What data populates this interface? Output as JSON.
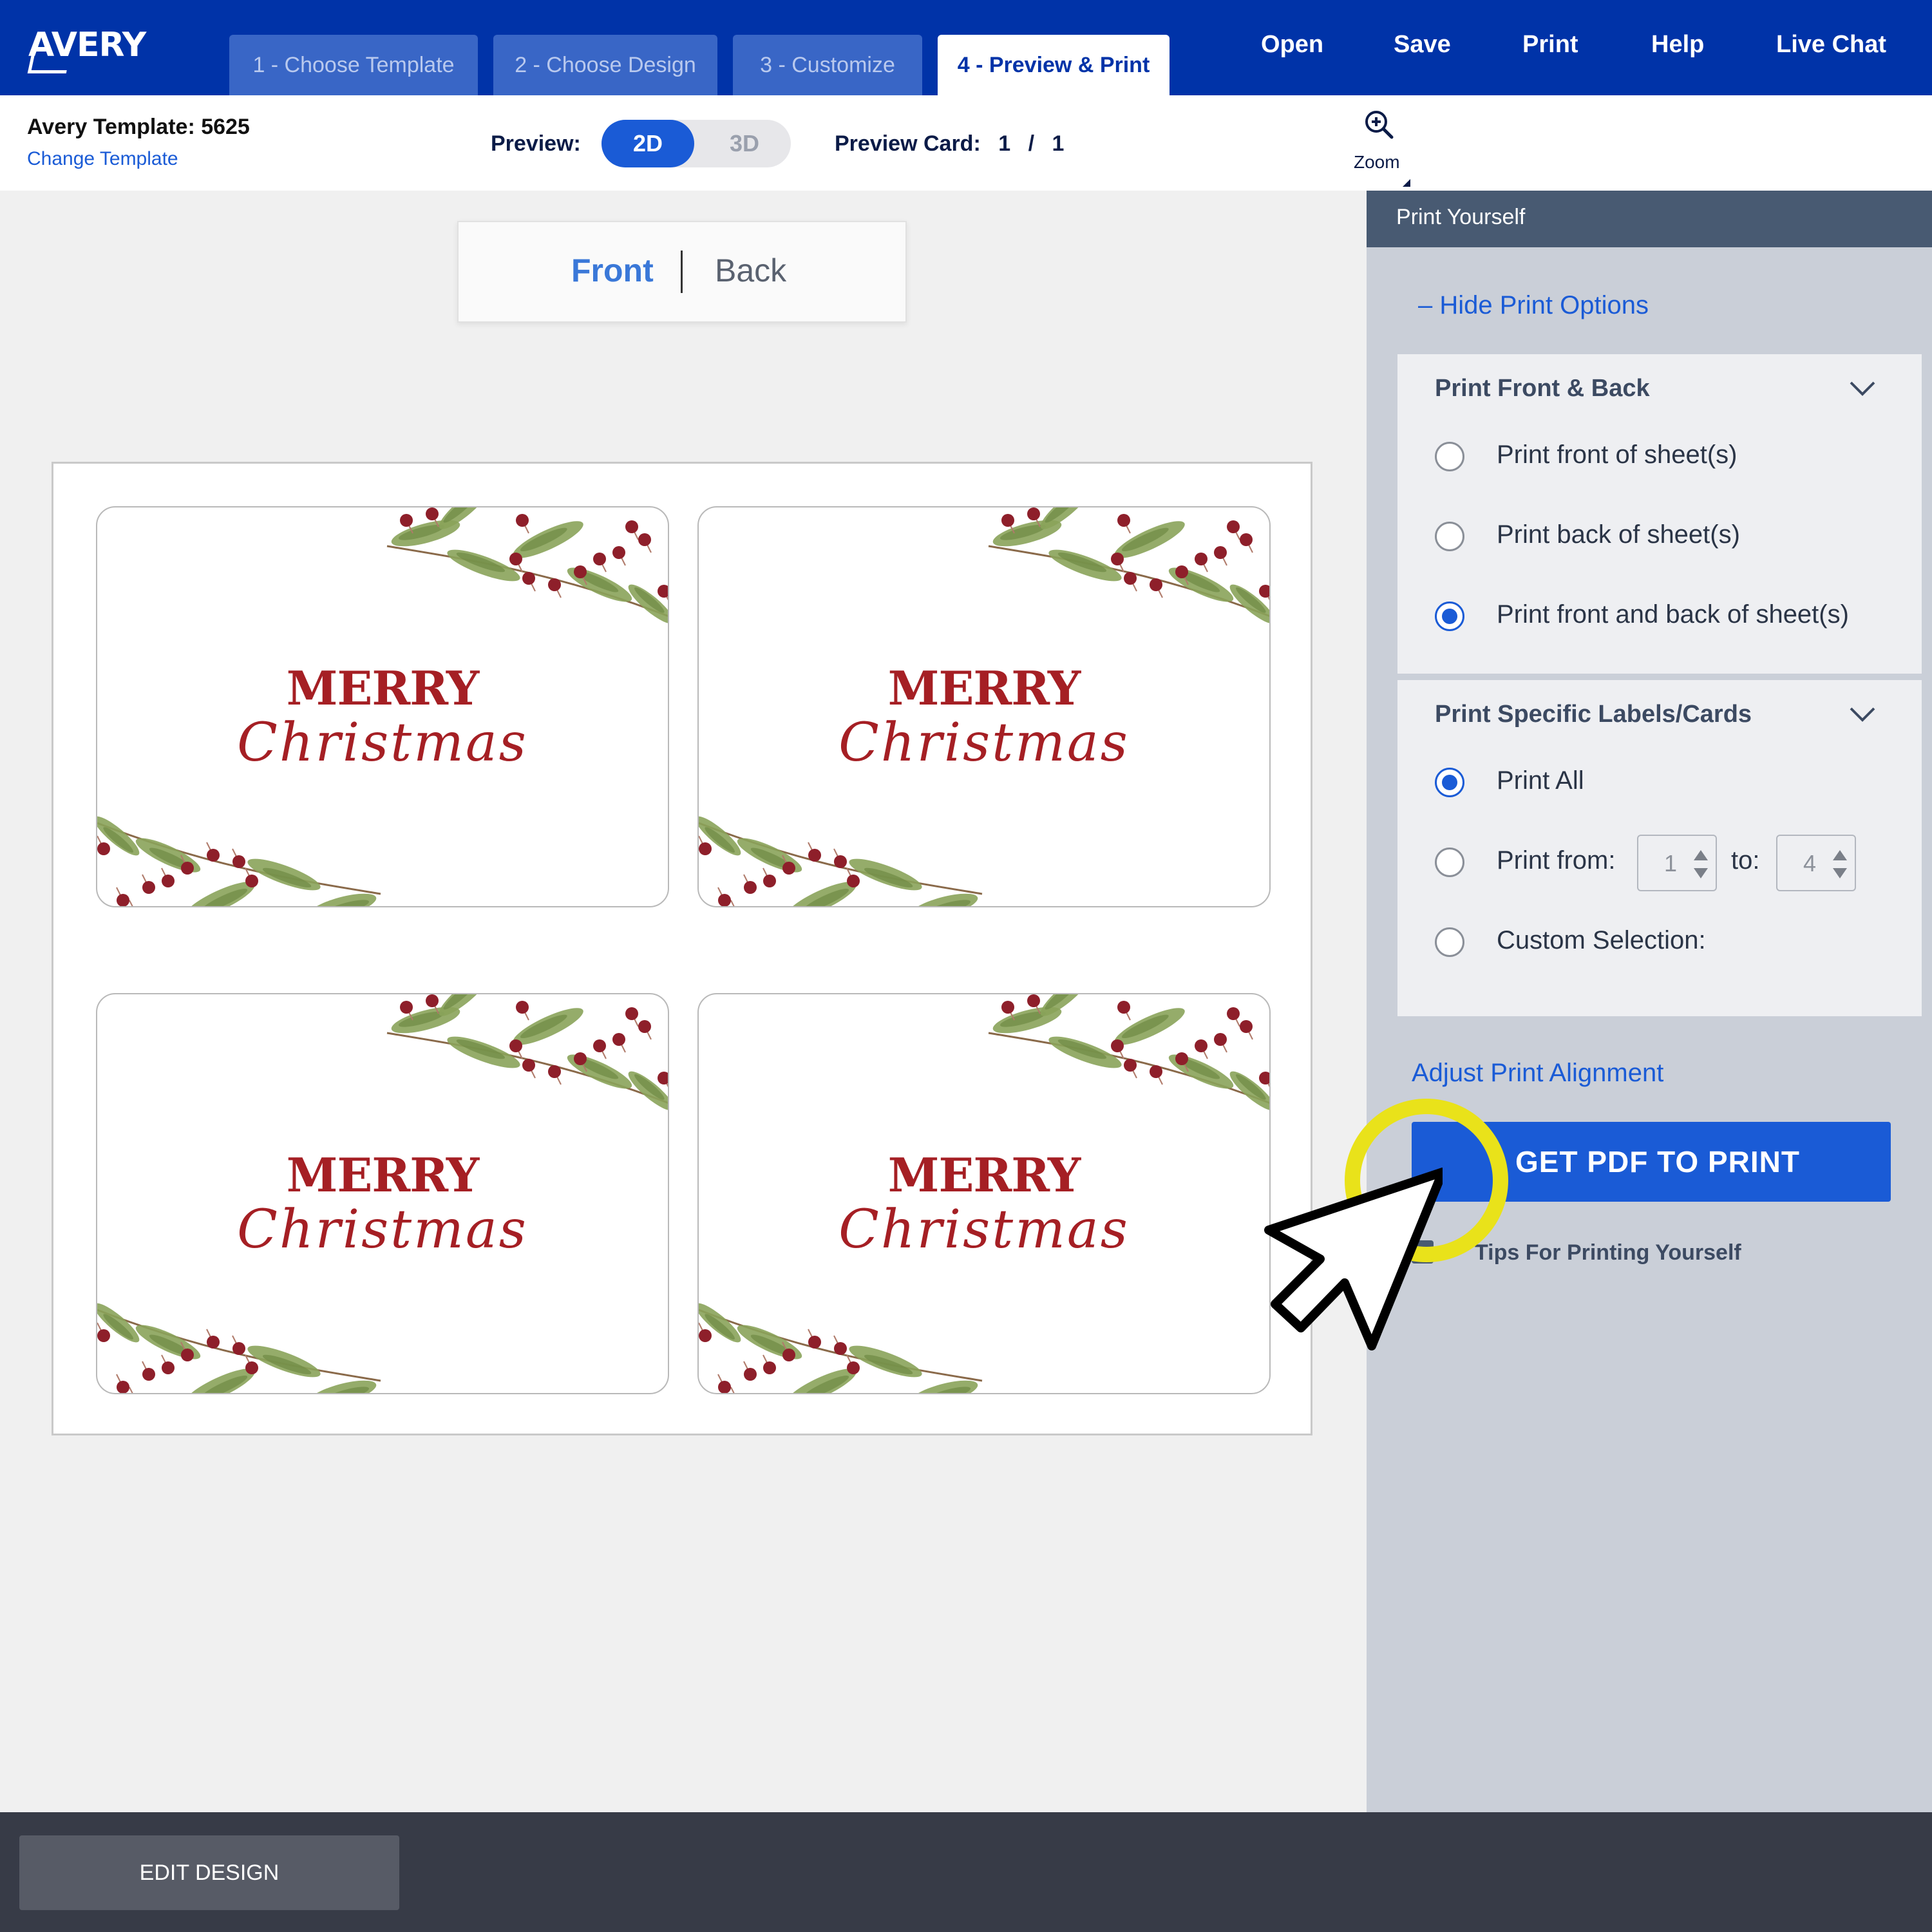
{
  "brand": {
    "logo_text": "AVERY"
  },
  "tabs": [
    {
      "label": "1 - Choose Template"
    },
    {
      "label": "2 - Choose Design"
    },
    {
      "label": "3 - Customize"
    },
    {
      "label": "4 - Preview & Print"
    }
  ],
  "nav": {
    "open": "Open",
    "save": "Save",
    "print": "Print",
    "help": "Help",
    "live_chat": "Live Chat"
  },
  "template": {
    "title": "Avery Template: 5625",
    "change_link": "Change Template"
  },
  "preview": {
    "label": "Preview:",
    "mode_2d": "2D",
    "mode_3d": "3D",
    "selected": "2D",
    "card_label": "Preview Card:",
    "card_current": "1",
    "card_separator": "/",
    "card_total": "1"
  },
  "zoom": {
    "label": "Zoom",
    "icon": "zoom-in-icon"
  },
  "side_toggle": {
    "front": "Front",
    "back": "Back",
    "selected": "Front"
  },
  "cards": [
    {
      "line1": "MERRY",
      "line2": "Christmas"
    },
    {
      "line1": "MERRY",
      "line2": "Christmas"
    },
    {
      "line1": "MERRY",
      "line2": "Christmas"
    },
    {
      "line1": "MERRY",
      "line2": "Christmas"
    }
  ],
  "panel": {
    "title": "Print Yourself",
    "hide_options": "– Hide Print Options",
    "front_back": {
      "title": "Print Front & Back",
      "options": [
        "Print front of sheet(s)",
        "Print back of sheet(s)",
        "Print front and back of sheet(s)"
      ],
      "selected_index": 2
    },
    "specific": {
      "title": "Print Specific Labels/Cards",
      "print_all": "Print All",
      "print_from": "Print from:",
      "from_value": "1",
      "to_label": "to:",
      "to_value": "4",
      "custom": "Custom Selection:",
      "selected": "Print All"
    },
    "adjust_alignment": "Adjust Print Alignment",
    "get_pdf": "GET PDF TO PRINT",
    "tips": "Tips For Printing Yourself"
  },
  "footer": {
    "edit_design": "EDIT DESIGN"
  },
  "colors": {
    "brand_blue": "#0033a8",
    "accent_blue": "#1a5bd6",
    "christmas_red": "#a51f24",
    "highlight_yellow": "#e9e21a"
  }
}
